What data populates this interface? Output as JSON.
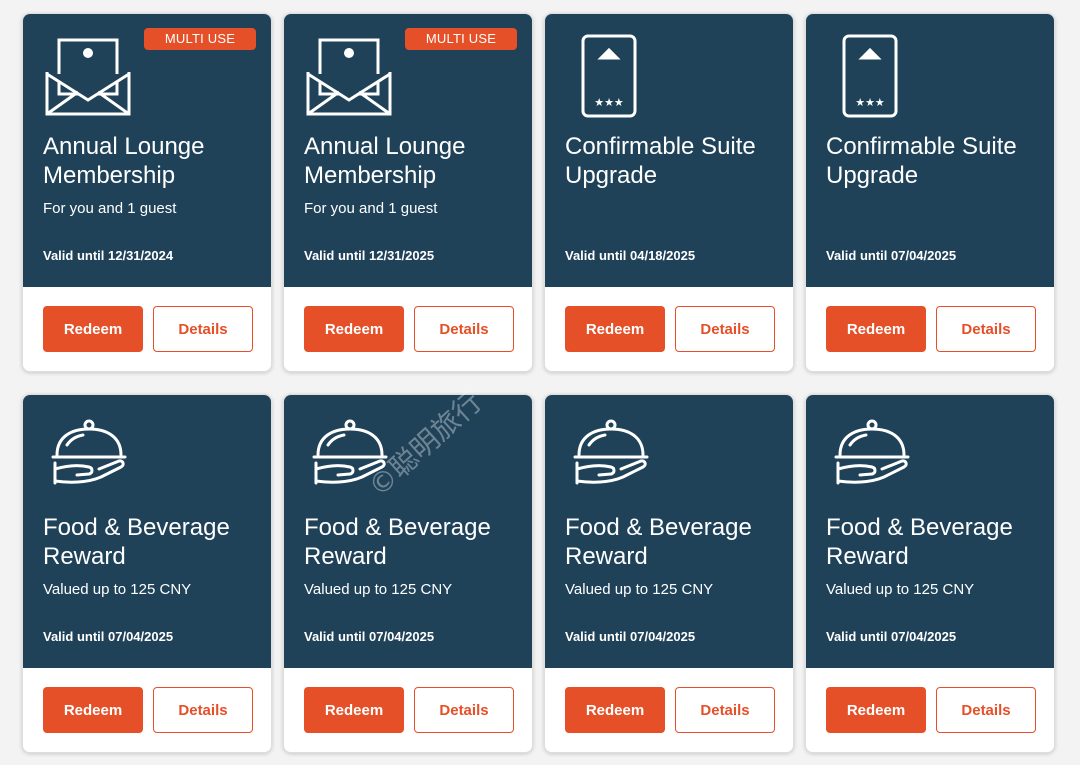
{
  "cards": [
    {
      "badge": "MULTI USE",
      "icon": "envelope-icon",
      "title": "Annual Lounge Membership",
      "subtitle": "For you and 1 guest",
      "valid": "Valid until 12/31/2024",
      "redeem": "Redeem",
      "details": "Details"
    },
    {
      "badge": "MULTI USE",
      "icon": "envelope-icon",
      "title": "Annual Lounge Membership",
      "subtitle": "For you and 1 guest",
      "valid": "Valid until 12/31/2025",
      "redeem": "Redeem",
      "details": "Details"
    },
    {
      "badge": "",
      "icon": "room-keycard-icon",
      "title": "Confirmable Suite Upgrade",
      "subtitle": "",
      "valid": "Valid until 04/18/2025",
      "redeem": "Redeem",
      "details": "Details"
    },
    {
      "badge": "",
      "icon": "room-keycard-icon",
      "title": "Confirmable Suite Upgrade",
      "subtitle": "",
      "valid": "Valid until 07/04/2025",
      "redeem": "Redeem",
      "details": "Details"
    },
    {
      "badge": "",
      "icon": "cloche-hand-icon",
      "title": "Food & Beverage Reward",
      "subtitle": "Valued up to 125 CNY",
      "valid": "Valid until 07/04/2025",
      "redeem": "Redeem",
      "details": "Details"
    },
    {
      "badge": "",
      "icon": "cloche-hand-icon",
      "title": "Food & Beverage Reward",
      "subtitle": "Valued up to 125 CNY",
      "valid": "Valid until 07/04/2025",
      "redeem": "Redeem",
      "details": "Details"
    },
    {
      "badge": "",
      "icon": "cloche-hand-icon",
      "title": "Food & Beverage Reward",
      "subtitle": "Valued up to 125 CNY",
      "valid": "Valid until 07/04/2025",
      "redeem": "Redeem",
      "details": "Details"
    },
    {
      "badge": "",
      "icon": "cloche-hand-icon",
      "title": "Food & Beverage Reward",
      "subtitle": "Valued up to 125 CNY",
      "valid": "Valid until 07/04/2025",
      "redeem": "Redeem",
      "details": "Details"
    }
  ],
  "watermark": "©聪明旅行",
  "colors": {
    "card_bg": "#1f4259",
    "accent": "#e55028",
    "page_bg": "#f3f3f3"
  }
}
